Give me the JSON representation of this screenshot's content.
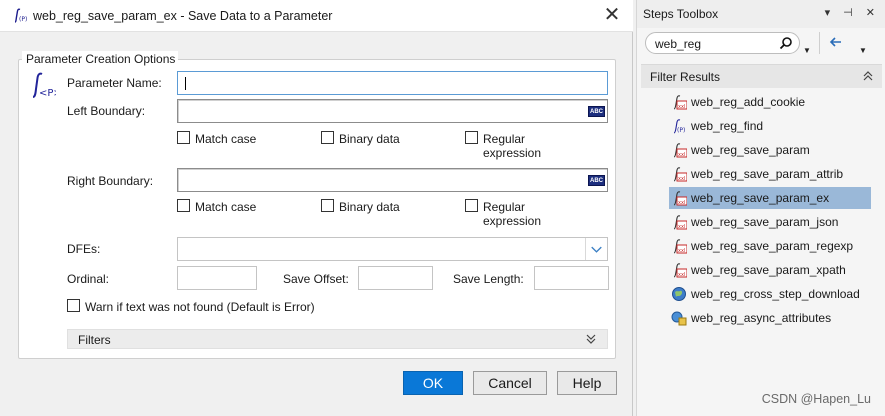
{
  "dialog": {
    "title": "web_reg_save_param_ex - Save Data to a Parameter",
    "close_glyph": "✕",
    "group_title": "Parameter Creation Options",
    "param_name_label": "Parameter Name:",
    "param_name_value": "",
    "left_boundary_label": "Left Boundary:",
    "right_boundary_label": "Right Boundary:",
    "abc_badge": "ABC",
    "left_options": {
      "match_case": "Match case",
      "binary_data": "Binary data",
      "regular_expression_1": "Regular",
      "regular_expression_2": "expression"
    },
    "right_options": {
      "match_case": "Match case",
      "binary_data": "Binary data",
      "regular_expression_1": "Regular",
      "regular_expression_2": "expression"
    },
    "dfes_label": "DFEs:",
    "ordinal_label": "Ordinal:",
    "save_offset_label": "Save Offset:",
    "save_length_label": "Save Length:",
    "warn_label": "Warn if text was not found (Default is Error)",
    "filters_label": "Filters",
    "buttons": {
      "ok": "OK",
      "cancel": "Cancel",
      "help": "Help"
    }
  },
  "toolbox": {
    "title": "Steps Toolbox",
    "controls": "▾ ⊣ ✕",
    "search_value": "web_reg",
    "filter_results_label": "Filter Results",
    "items": [
      {
        "label": "web_reg_add_cookie",
        "icon": "save-param-icon"
      },
      {
        "label": "web_reg_find",
        "icon": "find-param-icon"
      },
      {
        "label": "web_reg_save_param",
        "icon": "save-param-icon"
      },
      {
        "label": "web_reg_save_param_attrib",
        "icon": "save-param-icon"
      },
      {
        "label": "web_reg_save_param_ex",
        "icon": "save-param-icon",
        "selected": true
      },
      {
        "label": "web_reg_save_param_json",
        "icon": "save-param-icon"
      },
      {
        "label": "web_reg_save_param_regexp",
        "icon": "save-param-icon"
      },
      {
        "label": "web_reg_save_param_xpath",
        "icon": "save-param-icon"
      },
      {
        "label": "web_reg_cross_step_download",
        "icon": "globe-icon"
      },
      {
        "label": "web_reg_async_attributes",
        "icon": "async-icon"
      }
    ]
  },
  "watermark": "CSDN @Hapen_Lu",
  "colors": {
    "primary_button": "#0a78d7",
    "selected_item": "#9ab8d8",
    "abc_badge": "#1c2e7e"
  }
}
